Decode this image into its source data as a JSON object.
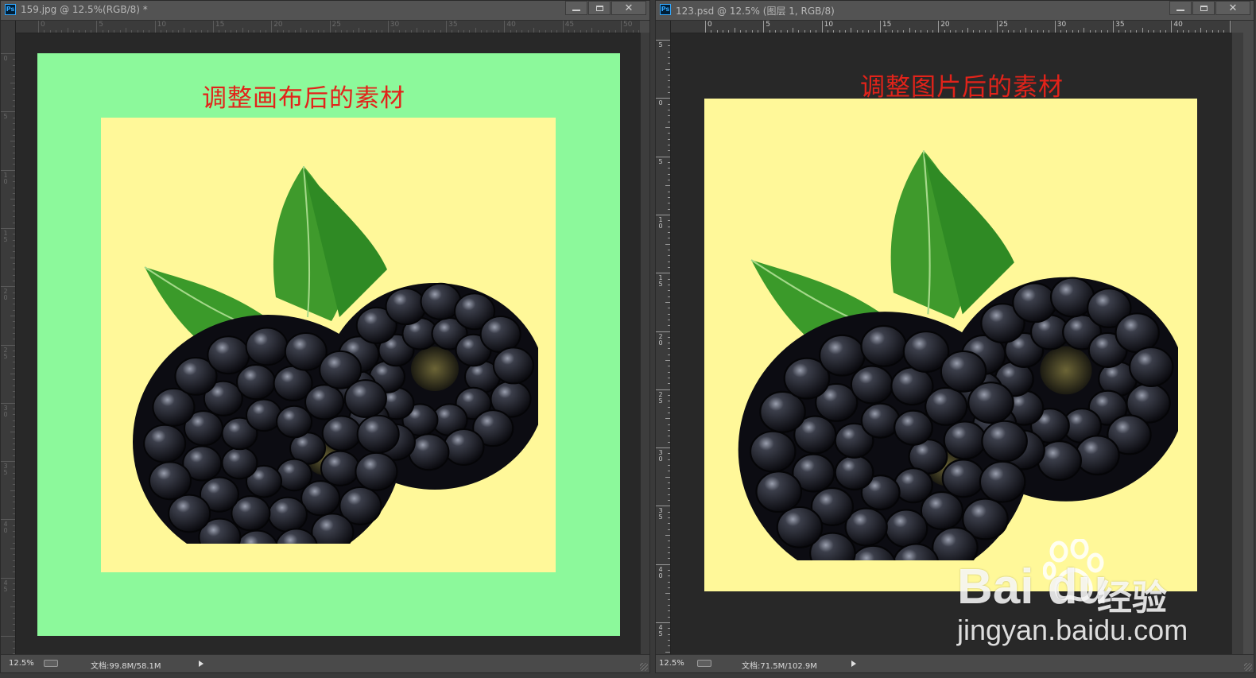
{
  "left_window": {
    "title": "159.jpg @ 12.5%(RGB/8) *",
    "canvas_title": "调整画布后的素材",
    "status": {
      "zoom": "12.5%",
      "doc": "文档:99.8M/58.1M"
    },
    "ruler_h": [
      "0",
      "5",
      "10",
      "15",
      "20",
      "25",
      "30",
      "35",
      "40",
      "45",
      "50"
    ],
    "ruler_v": [
      "0",
      "5",
      "1\n0",
      "1\n5",
      "2\n0",
      "2\n5",
      "3\n0",
      "3\n5",
      "4\n0",
      "4\n5"
    ]
  },
  "right_window": {
    "title": "123.psd @ 12.5% (图层 1, RGB/8)",
    "canvas_title": "调整图片后的素材",
    "status": {
      "zoom": "12.5%",
      "doc": "文档:71.5M/102.9M"
    },
    "ruler_h": [
      "0",
      "5",
      "10",
      "15",
      "20",
      "25",
      "30",
      "35",
      "40"
    ],
    "ruler_v": [
      "5",
      "0",
      "5",
      "1\n0",
      "1\n5",
      "2\n0",
      "2\n5",
      "3\n0",
      "3\n5",
      "4\n0",
      "4\n5"
    ]
  },
  "watermark": {
    "brand": "Bai du",
    "brand_cn": "经验",
    "url": "jingyan.baidu.com"
  },
  "colors": {
    "canvas_extension": "#8cf99b",
    "image_background": "#fff899",
    "title_red": "#e2231a"
  },
  "icons": {
    "app": "Ps"
  }
}
